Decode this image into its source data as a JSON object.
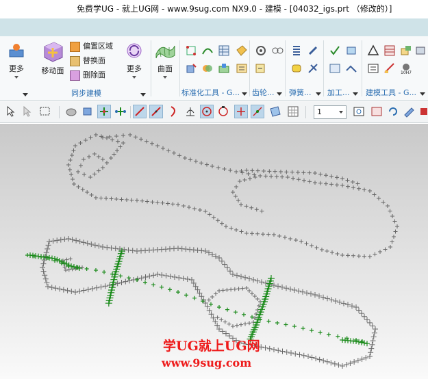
{
  "window": {
    "title": "免费学UG - 就上UG网 - www.9sug.com NX9.0 - 建模 - [04032_igs.prt （修改的）]"
  },
  "ribbon": {
    "groups": [
      {
        "label": "同步建模"
      },
      {
        "label": "标准化工具 - G..."
      },
      {
        "label": "齿轮..."
      },
      {
        "label": "弹簧..."
      },
      {
        "label": "加工..."
      },
      {
        "label": "建模工具 - G..."
      }
    ],
    "buttons": {
      "more_1": "更多",
      "move_face": "移动面",
      "offset_region": "偏置区域",
      "replace_face": "替换面",
      "delete_face": "删除面",
      "more_2": "更多",
      "surface": "曲面"
    }
  },
  "toolbar": {
    "selection_scale": "1"
  },
  "watermark": {
    "line1": "学UG就上UG网",
    "line2": "www.9sug.com"
  },
  "colors": {
    "tab_strip": "#cfe3e8",
    "accent_blue": "#2a6db0",
    "curve_points": "#666666",
    "selected_points": "#1a8a1a",
    "watermark": "#ee1b1b"
  }
}
